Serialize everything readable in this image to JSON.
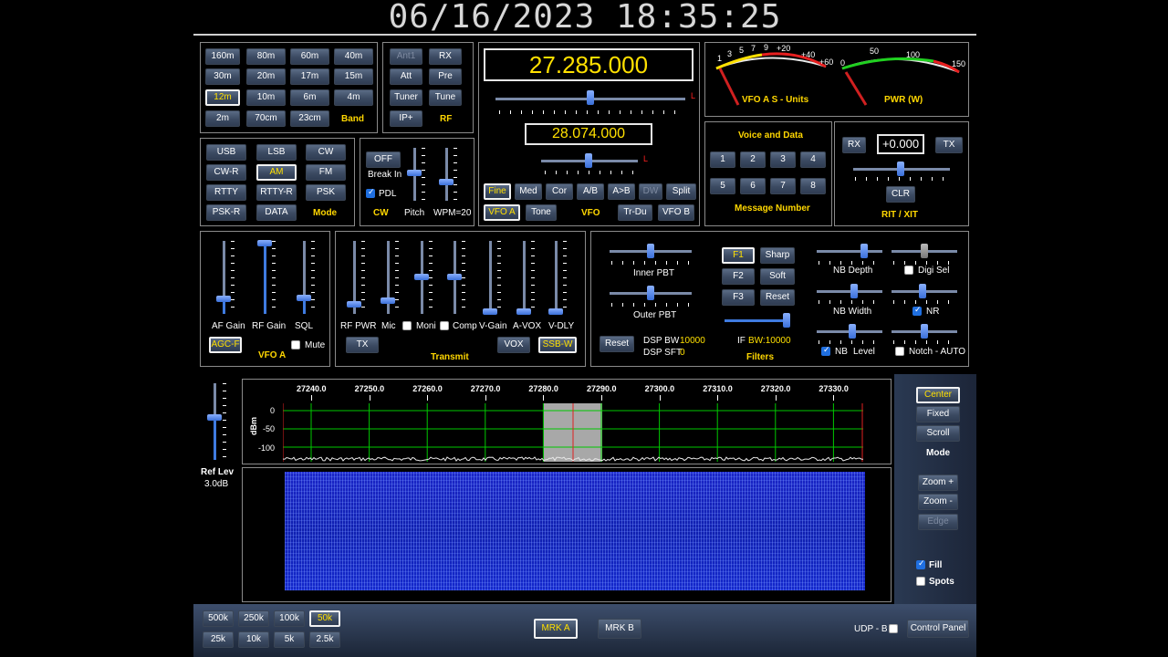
{
  "clock": "06/16/2023 18:35:25",
  "band": {
    "buttons": [
      "160m",
      "80m",
      "60m",
      "40m",
      "30m",
      "20m",
      "17m",
      "15m",
      "12m",
      "10m",
      "6m",
      "4m",
      "2m",
      "70cm",
      "23cm"
    ],
    "selected": "12m",
    "label": "Band"
  },
  "rf": {
    "buttons": [
      "Ant1",
      "RX",
      "Att",
      "Pre",
      "Tuner",
      "Tune",
      "IP+"
    ],
    "label": "RF"
  },
  "vfo": {
    "main_freq": "27.285.000",
    "sub_freq": "28.074.000",
    "buttons_row1": [
      "Fine",
      "Med",
      "Cor",
      "A/B",
      "A>B",
      "DW",
      "Split"
    ],
    "buttons_row2": [
      "VFO A",
      "Tone",
      "Tr-Du",
      "VFO B"
    ],
    "label": "VFO",
    "marker_l": "L"
  },
  "meters": {
    "s_title": "VFO A S - Units",
    "s_scale": [
      "1",
      "3",
      "5",
      "7",
      "9",
      "+20",
      "+40",
      "+60"
    ],
    "pwr_title": "PWR (W)",
    "pwr_scale": [
      "0",
      "50",
      "100",
      "150"
    ]
  },
  "mode": {
    "buttons": [
      "USB",
      "LSB",
      "CW",
      "CW-R",
      "AM",
      "FM",
      "RTTY",
      "RTTY-R",
      "PSK",
      "PSK-R",
      "DATA"
    ],
    "selected": "AM",
    "label": "Mode"
  },
  "cw": {
    "off_label": "OFF",
    "break_in": "Break In",
    "pdl": "PDL",
    "label": "CW",
    "pitch": "Pitch",
    "wpm": "WPM=20"
  },
  "message": {
    "title": "Voice and Data",
    "buttons": [
      "1",
      "2",
      "3",
      "4",
      "5",
      "6",
      "7",
      "8"
    ],
    "label": "Message Number"
  },
  "rit": {
    "rx": "RX",
    "value": "+0.000",
    "tx": "TX",
    "clr": "CLR",
    "label": "RIT / XIT"
  },
  "vfoa_panel": {
    "af": "AF Gain",
    "rf": "RF Gain",
    "sql": "SQL",
    "agc": "AGC-F",
    "mute": "Mute",
    "label": "VFO A"
  },
  "transmit": {
    "sliders": [
      "RF PWR",
      "Mic",
      "Moni",
      "Comp",
      "V-Gain",
      "A-VOX",
      "V-DLY"
    ],
    "tx": "TX",
    "vox": "VOX",
    "ssb": "SSB-W",
    "label": "Transmit"
  },
  "filters": {
    "inner": "Inner PBT",
    "outer": "Outer PBT",
    "f1": "F1",
    "f2": "F2",
    "f3": "F3",
    "sharp": "Sharp",
    "soft": "Soft",
    "reset": "Reset",
    "reset_left": "Reset",
    "dsp_bw": "DSP BW",
    "dsp_bw_val": "10000",
    "dsp_sft": "DSP SFT",
    "dsp_sft_val": "0",
    "if_label": "IF",
    "if_bw": "BW:10000",
    "label": "Filters"
  },
  "nb": {
    "depth": "NB Depth",
    "digi_sel": "Digi Sel",
    "width": "NB Width",
    "nr": "NR",
    "nb": "NB",
    "level": "Level",
    "notch": "Notch - AUTO"
  },
  "spectrum": {
    "freq_labels": [
      "27240.0",
      "27250.0",
      "27260.0",
      "27270.0",
      "27280.0",
      "27290.0",
      "27300.0",
      "27310.0",
      "27320.0",
      "27330.0"
    ],
    "y_labels": [
      "0",
      "-50",
      "-100"
    ],
    "y_unit": "dBm",
    "ref_label": "Ref Lev",
    "ref_value": "3.0dB"
  },
  "view_mode": {
    "buttons": [
      "Center",
      "Fixed",
      "Scroll"
    ],
    "selected": "Center",
    "label": "Mode",
    "zoom_in": "Zoom +",
    "zoom_out": "Zoom -",
    "edge": "Edge",
    "fill": "Fill",
    "spots": "Spots"
  },
  "bottom": {
    "spans": [
      "500k",
      "250k",
      "100k",
      "50k",
      "25k",
      "10k",
      "5k",
      "2.5k"
    ],
    "selected_span": "50k",
    "mrk_a": "MRK A",
    "mrk_b": "MRK B",
    "udp": "UDP - B",
    "control": "Control Panel"
  },
  "colors": {
    "accent": "#ffd700",
    "freq": "#ffe000",
    "grid": "#00c800",
    "button": "#3b4a62"
  }
}
